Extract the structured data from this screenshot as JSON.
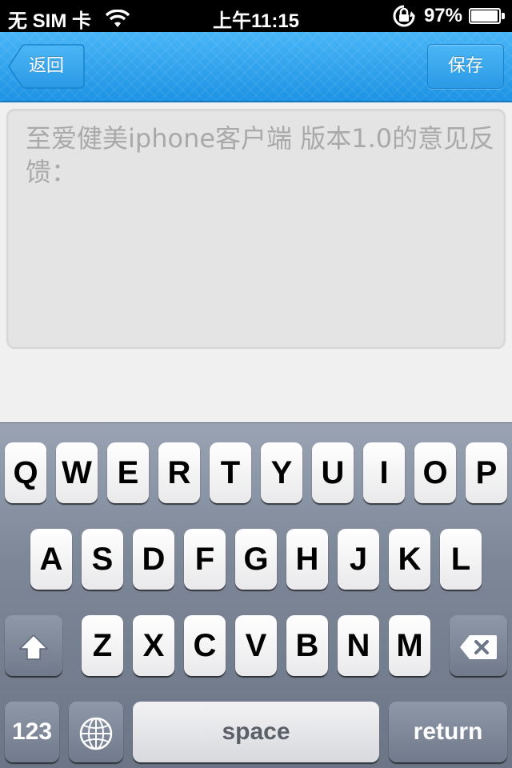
{
  "status_bar": {
    "carrier": "无 SIM 卡",
    "time": "上午11:15",
    "battery_percent": "97%",
    "battery_level": 0.97,
    "icons": [
      "wifi-icon",
      "rotation-lock-icon",
      "battery-icon"
    ]
  },
  "nav_bar": {
    "back_label": "返回",
    "save_label": "保存",
    "accent_color": "#1d93e4"
  },
  "feedback": {
    "placeholder": "至爱健美iphone客户端 版本1.0的意见反馈："
  },
  "keyboard": {
    "row1": [
      "Q",
      "W",
      "E",
      "R",
      "T",
      "Y",
      "U",
      "I",
      "O",
      "P"
    ],
    "row2": [
      "A",
      "S",
      "D",
      "F",
      "G",
      "H",
      "J",
      "K",
      "L"
    ],
    "row3": [
      "Z",
      "X",
      "C",
      "V",
      "B",
      "N",
      "M"
    ],
    "numbers_label": "123",
    "space_label": "space",
    "return_label": "return",
    "icons": [
      "shift-icon",
      "backspace-icon",
      "globe-icon"
    ]
  }
}
